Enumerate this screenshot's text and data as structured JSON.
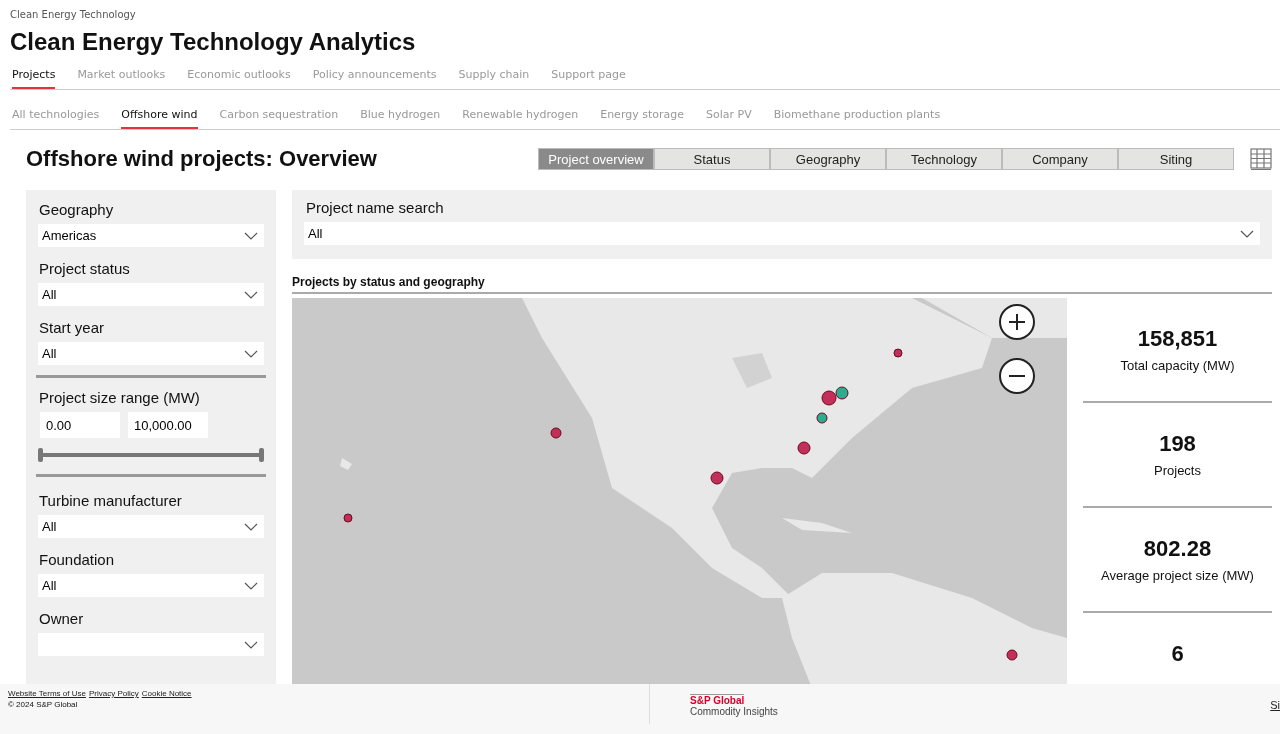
{
  "breadcrumb": "Clean Energy Technology",
  "title": "Clean Energy Technology Analytics",
  "tabs": [
    {
      "label": "Projects",
      "selected": true
    },
    {
      "label": "Market outlooks",
      "selected": false
    },
    {
      "label": "Economic outlooks",
      "selected": false
    },
    {
      "label": "Policy announcements",
      "selected": false
    },
    {
      "label": "Supply chain",
      "selected": false
    },
    {
      "label": "Support page",
      "selected": false
    }
  ],
  "technology_tabs": [
    {
      "label": "All technologies",
      "selected": false
    },
    {
      "label": "Offshore wind",
      "selected": true
    },
    {
      "label": "Carbon sequestration",
      "selected": false
    },
    {
      "label": "Blue hydrogen",
      "selected": false
    },
    {
      "label": "Renewable hydrogen",
      "selected": false
    },
    {
      "label": "Energy storage",
      "selected": false
    },
    {
      "label": "Solar PV",
      "selected": false
    },
    {
      "label": "Biomethane production plants",
      "selected": false
    }
  ],
  "page_heading": "Offshore wind projects: Overview",
  "view_tabs": [
    {
      "label": "Project overview",
      "selected": true
    },
    {
      "label": "Status",
      "selected": false
    },
    {
      "label": "Geography",
      "selected": false
    },
    {
      "label": "Technology",
      "selected": false
    },
    {
      "label": "Company",
      "selected": false
    },
    {
      "label": "Siting",
      "selected": false
    }
  ],
  "filters": [
    {
      "kind": "dropdown",
      "label": "Geography",
      "value": "Americas"
    },
    {
      "kind": "dropdown",
      "label": "Project status",
      "value": "All"
    },
    {
      "kind": "dropdown",
      "label": "Start year",
      "value": "All"
    },
    {
      "kind": "range",
      "label": "Project size range (MW)",
      "min": "0.00",
      "max": "10,000.00",
      "level": 1
    },
    {
      "kind": "dropdown",
      "label": "Turbine manufacturer",
      "value": "All"
    },
    {
      "kind": "dropdown",
      "label": "Foundation",
      "value": "All"
    },
    {
      "kind": "dropdown",
      "label": "Owner"
    }
  ],
  "search": {
    "label": "Project name search",
    "value": "All"
  },
  "map_title": "Projects by status and geography",
  "stats": [
    {
      "value": "158,851",
      "label": "Total capacity (MW)"
    },
    {
      "value": "198",
      "label": "Projects"
    },
    {
      "value": "802.28",
      "label": "Average project size (MW)"
    },
    {
      "value": "6"
    }
  ],
  "footer": {
    "links": [
      "Website Terms of Use",
      "Privacy Policy",
      "Cookie Notice"
    ],
    "copyright": "© 2024 S&P Global",
    "brand": "S&P Global",
    "brand_sub": "Commodity Insights",
    "edge_link": "Si"
  }
}
